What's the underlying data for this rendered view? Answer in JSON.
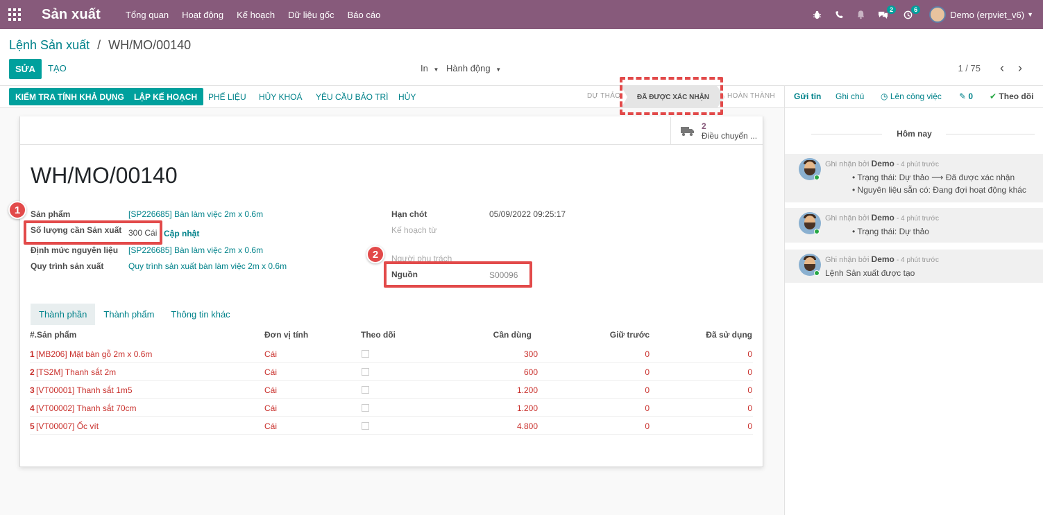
{
  "nav": {
    "app_title": "Sản xuất",
    "menu": [
      "Tổng quan",
      "Hoạt động",
      "Kế hoạch",
      "Dữ liệu gốc",
      "Báo cáo"
    ],
    "messages_count": "2",
    "activities_count": "6",
    "user": "Demo (erpviet_v6)"
  },
  "breadcrumb": {
    "parent": "Lệnh Sản xuất",
    "separator": "/",
    "current": "WH/MO/00140"
  },
  "toolbar": {
    "edit": "SỬA",
    "create": "TẠO",
    "print": "In",
    "action": "Hành động",
    "pager": "1 / 75"
  },
  "statusbar": {
    "buttons": [
      "KIỂM TRA TÍNH KHẢ DỤNG",
      "LẬP KẾ HOẠCH",
      "PHẾ LIỆU",
      "HỦY KHOÁ",
      "YÊU CẦU BẢO TRÌ",
      "HỦY"
    ],
    "stages": {
      "draft": "DỰ THẢO",
      "confirmed": "ĐÃ ĐƯỢC XÁC NHẬN",
      "done": "HOÀN THÀNH"
    }
  },
  "smart_button": {
    "count": "2",
    "label": "Điều chuyển ..."
  },
  "form": {
    "title": "WH/MO/00140",
    "product_label": "Sản phẩm",
    "product_value": "[SP226685] Bàn làm việc 2m x 0.6m",
    "qty_label": "Số lượng cần Sản xuất",
    "qty_value": "300 Cái",
    "qty_update": "Cập nhật",
    "bom_label": "Định mức nguyên liệu",
    "bom_value": "[SP226685] Bàn làm việc 2m x 0.6m",
    "routing_label": "Quy trình sản xuất",
    "routing_value": "Quy trình sản xuất bàn làm việc 2m x 0.6m",
    "deadline_label": "Hạn chót",
    "deadline_value": "05/09/2022 09:25:17",
    "planned_label": "Kế hoạch từ",
    "responsible_label": "Người phụ trách",
    "source_label": "Nguồn",
    "source_value": "S00096"
  },
  "annotations": {
    "one": "1",
    "two": "2"
  },
  "tabs": [
    "Thành phần",
    "Thành phẩm",
    "Thông tin khác"
  ],
  "table": {
    "headers": [
      "#.Sản phẩm",
      "Đơn vị tính",
      "Theo dõi",
      "Cần dùng",
      "Giữ trước",
      "Đã sử dụng"
    ],
    "rows": [
      {
        "no": "1",
        "product": "[MB206] Mặt bàn gỗ 2m x 0.6m",
        "uom": "Cái",
        "need": "300",
        "reserved": "0",
        "used": "0"
      },
      {
        "no": "2",
        "product": "[TS2M] Thanh sắt 2m",
        "uom": "Cái",
        "need": "600",
        "reserved": "0",
        "used": "0"
      },
      {
        "no": "3",
        "product": "[VT00001] Thanh sắt 1m5",
        "uom": "Cái",
        "need": "1.200",
        "reserved": "0",
        "used": "0"
      },
      {
        "no": "4",
        "product": "[VT00002] Thanh sắt 70cm",
        "uom": "Cái",
        "need": "1.200",
        "reserved": "0",
        "used": "0"
      },
      {
        "no": "5",
        "product": "[VT00007] Ốc vít",
        "uom": "Cái",
        "need": "4.800",
        "reserved": "0",
        "used": "0"
      }
    ]
  },
  "chatter": {
    "send": "Gửi tin",
    "note": "Ghi chú",
    "schedule": "Lên công việc",
    "attachments": "0",
    "follow": "Theo dõi",
    "today": "Hôm nay",
    "messages": [
      {
        "prefix": "Ghi nhận bởi",
        "author": "Demo",
        "time": "- 4 phút trước",
        "lines": [
          "Trạng thái: Dự thảo ⟶ Đã được xác nhận",
          "Nguyên liệu sẵn có: Đang đợi hoạt động khác"
        ]
      },
      {
        "prefix": "Ghi nhận bởi",
        "author": "Demo",
        "time": "- 4 phút trước",
        "lines": [
          "Trạng thái: Dự thảo"
        ]
      },
      {
        "prefix": "Ghi nhận bởi",
        "author": "Demo",
        "time": "- 4 phút trước",
        "body": "Lệnh Sản xuất được tạo"
      }
    ]
  },
  "colors": {
    "brand": "#875a7b",
    "primary": "#00a09d",
    "link": "#00828a",
    "highlight": "#e24a4a",
    "row_text": "#c9302c"
  }
}
